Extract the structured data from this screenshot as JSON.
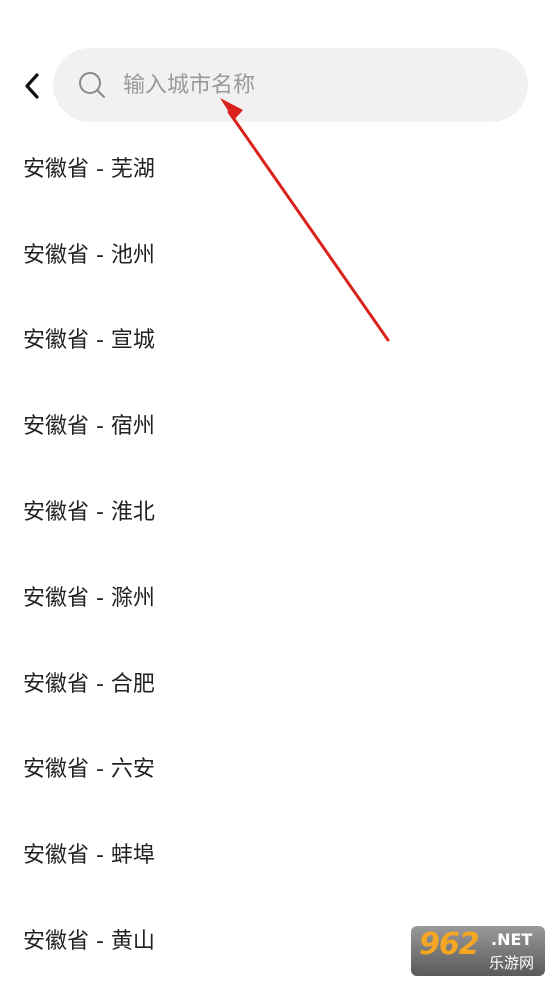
{
  "header": {
    "back_icon": "chevron-left-icon",
    "search": {
      "icon": "search-icon",
      "placeholder": "输入城市名称",
      "value": ""
    }
  },
  "cities": [
    "安徽省 - 芜湖",
    "安徽省 - 池州",
    "安徽省 - 宣城",
    "安徽省 - 宿州",
    "安徽省 - 淮北",
    "安徽省 - 滁州",
    "安徽省 - 合肥",
    "安徽省 - 六安",
    "安徽省 - 蚌埠",
    "安徽省 - 黄山"
  ],
  "annotation": {
    "arrow_color": "#d9231c"
  },
  "watermark": {
    "number": "962",
    "suffix": ".NET",
    "chinese": "乐游网"
  },
  "colors": {
    "search_bg": "#f2f0f0",
    "placeholder": "#9a9a9a",
    "text": "#222222"
  }
}
